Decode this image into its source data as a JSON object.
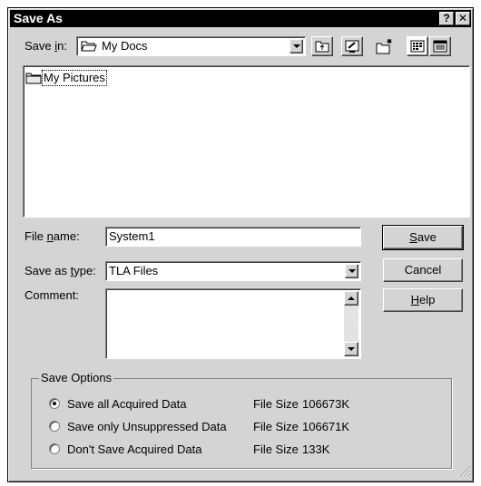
{
  "window": {
    "title": "Save As",
    "help_btn": "?",
    "close_btn": "✕"
  },
  "toolbar": {
    "save_in_label": "Save in:",
    "save_in_mnemonic": "i",
    "location": "My Docs"
  },
  "file_list": {
    "items": [
      {
        "name": "My Pictures",
        "icon": "folder-icon"
      }
    ]
  },
  "form": {
    "file_name_label": "File name:",
    "file_name_mnemonic": "n",
    "file_name_value": "System1",
    "save_type_label": "Save as type:",
    "save_type_mnemonic": "t",
    "save_type_value": "TLA Files",
    "comment_label": "Comment:",
    "comment_value": ""
  },
  "buttons": {
    "save": "Save",
    "cancel": "Cancel",
    "help": "Help"
  },
  "save_options": {
    "title": "Save Options",
    "options": [
      {
        "label": "Save all Acquired Data",
        "size_label": "File Size",
        "size": "106673K",
        "selected": true
      },
      {
        "label": "Save only Unsuppressed Data",
        "size_label": "File Size",
        "size": "106671K",
        "selected": false
      },
      {
        "label": "Don't Save Acquired Data",
        "size_label": "File Size",
        "size": "133K",
        "selected": false
      }
    ]
  }
}
